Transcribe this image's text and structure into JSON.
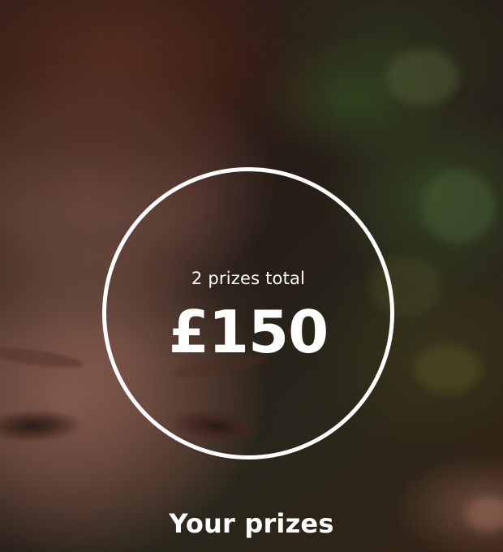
{
  "prize_summary": {
    "count_text": "2 prizes total",
    "amount_text": "£150"
  },
  "section": {
    "title": "Your prizes"
  },
  "colors": {
    "text": "#FFFFFF",
    "ring": "#FFFFFF"
  }
}
